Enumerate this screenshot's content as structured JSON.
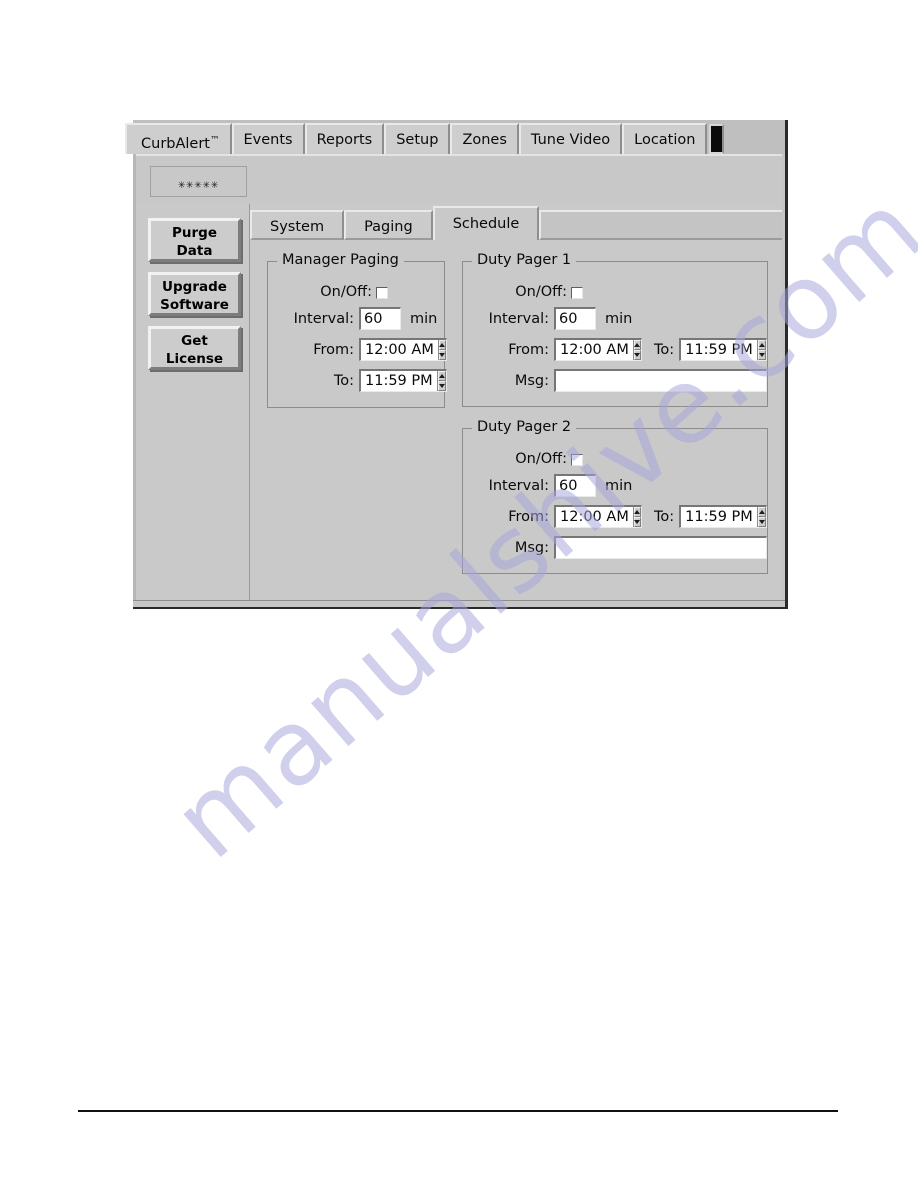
{
  "window": {
    "outer_tabs": [
      {
        "label": "CurbAlert",
        "trademark": "™",
        "selected": true
      },
      {
        "label": "Events",
        "selected": false
      },
      {
        "label": "Reports",
        "selected": false
      },
      {
        "label": "Setup",
        "selected": false
      },
      {
        "label": "Zones",
        "selected": false
      },
      {
        "label": "Tune Video",
        "selected": false
      },
      {
        "label": "Location",
        "selected": false
      }
    ],
    "password_field": {
      "value": "✳✳✳✳✳",
      "placeholder": ""
    },
    "sidebar": {
      "buttons": [
        {
          "line1": "Purge",
          "line2": "Data"
        },
        {
          "line1": "Upgrade",
          "line2": "Software"
        },
        {
          "line1": "Get",
          "line2": "License"
        }
      ]
    },
    "inner_tabs": [
      {
        "label": "System",
        "selected": false
      },
      {
        "label": "Paging",
        "selected": false
      },
      {
        "label": "Schedule",
        "selected": true
      }
    ]
  },
  "manager_paging": {
    "title": "Manager Paging",
    "onoff_label": "On/Off:",
    "onoff_checked": false,
    "interval_label": "Interval:",
    "interval_value": "60",
    "interval_suffix": "min",
    "from_label": "From:",
    "from_value": "12:00 AM",
    "to_label": "To:",
    "to_value": "11:59 PM"
  },
  "duty_pager_1": {
    "title": "Duty Pager 1",
    "onoff_label": "On/Off:",
    "onoff_checked": false,
    "interval_label": "Interval:",
    "interval_value": "60",
    "interval_suffix": "min",
    "from_label": "From:",
    "from_value": "12:00 AM",
    "to_label": "To:",
    "to_value": "11:59 PM",
    "msg_label": "Msg:",
    "msg_value": "",
    "msg_placeholder": ""
  },
  "duty_pager_2": {
    "title": "Duty Pager 2",
    "onoff_label": "On/Off:",
    "onoff_checked": false,
    "interval_label": "Interval:",
    "interval_value": "60",
    "interval_suffix": "min",
    "from_label": "From:",
    "from_value": "12:00 AM",
    "to_label": "To:",
    "to_value": "11:59 PM",
    "msg_label": "Msg:",
    "msg_value": "",
    "msg_placeholder": ""
  },
  "watermark": {
    "text": "manualshive.com"
  },
  "colors": {
    "window_face": "#c9c9c9",
    "field_bg": "#ffffff",
    "text": "#0a0a0a",
    "watermark": "#a6a6dd",
    "endcap": "#0b0b0b"
  }
}
